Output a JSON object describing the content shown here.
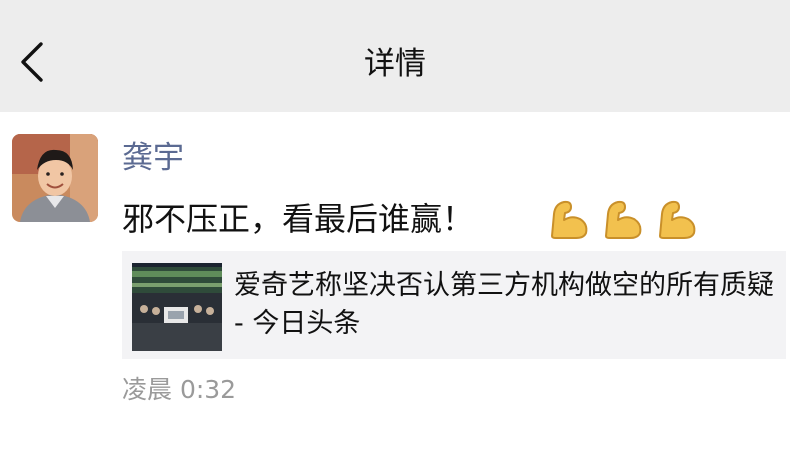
{
  "header": {
    "back_icon": "chevron-left-icon",
    "title": "详情"
  },
  "post": {
    "author": "龚宇",
    "text": "邪不压正，看最后谁赢！",
    "emoji_icon": "flexed-biceps-icon",
    "emoji_count": 3,
    "link_card": {
      "title": "爱奇艺称坚决否认第三方机构做空的所有质疑 - 今日头条"
    },
    "timestamp": "凌晨 0:32"
  },
  "colors": {
    "navbar_bg": "#ededed",
    "author_name": "#5b6a92",
    "card_bg": "#f3f3f5",
    "timestamp": "#9a9a9a",
    "emoji": "#f2c14e"
  }
}
